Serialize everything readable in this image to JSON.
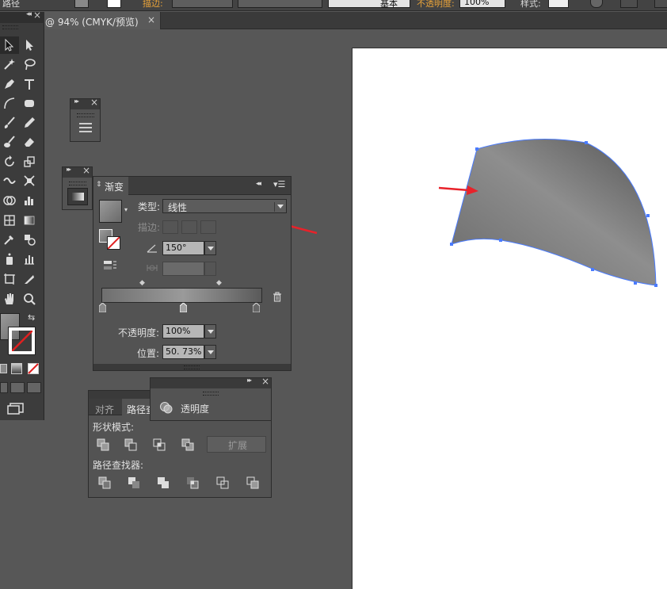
{
  "topbar": {
    "left_label": "路径",
    "stroke_label": "描边:",
    "brush_value": "基本",
    "opacity_label": "不透明度:",
    "opacity_value": "100%",
    "style_label": "样式:"
  },
  "document_tab": {
    "label": "@ 94% (CMYK/预览)",
    "close": "×"
  },
  "colors": {
    "app_bg": "#575757",
    "panel_bg": "#535353",
    "selection": "#4a7bff",
    "arrow": "#e8222a"
  },
  "gradient_panel": {
    "tab_label": "渐变",
    "type_label": "类型:",
    "type_value": "线性",
    "stroke_label": "描边:",
    "angle_value": "150°",
    "opacity_label": "不透明度:",
    "opacity_value": "100%",
    "location_label": "位置:",
    "location_value": "50. 73%"
  },
  "pathfinder_panel": {
    "tab_align": "对齐",
    "tab_pathfinder": "路径查",
    "shape_modes_label": "形状模式:",
    "expand_label": "扩展",
    "pathfinders_label": "路径查找器:"
  },
  "transparency_panel": {
    "label": "透明度"
  },
  "icons": {
    "panel_menu": "hamburger-icon",
    "trash": "trash-icon"
  }
}
